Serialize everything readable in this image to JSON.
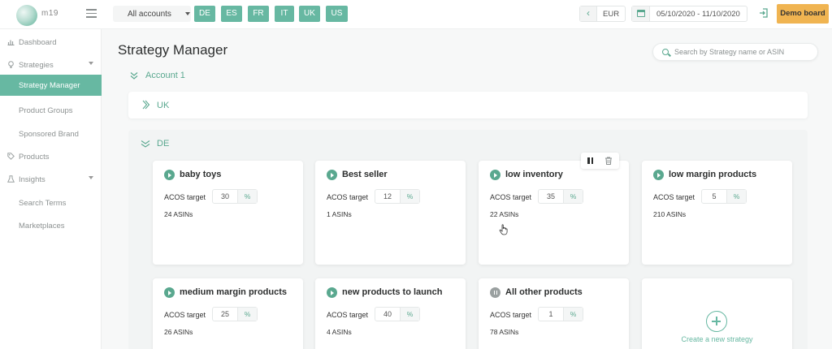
{
  "topbar": {
    "logo_text": "m19",
    "account_select": "All accounts",
    "marketplaces": [
      "DE",
      "ES",
      "FR",
      "IT",
      "UK",
      "US"
    ],
    "currency": "EUR",
    "date_range": "05/10/2020 - 11/10/2020",
    "demo_label": "Demo board"
  },
  "sidebar": {
    "items": [
      {
        "label": "Dashboard",
        "icon": "chart-icon"
      },
      {
        "label": "Strategies",
        "icon": "bulb-icon"
      },
      {
        "label": "Strategy Manager"
      },
      {
        "label": "Product Groups"
      },
      {
        "label": "Sponsored Brand"
      },
      {
        "label": "Products",
        "icon": "tag-icon"
      },
      {
        "label": "Insights",
        "icon": "flask-icon"
      },
      {
        "label": "Search Terms"
      },
      {
        "label": "Marketplaces"
      }
    ]
  },
  "main": {
    "title": "Strategy Manager",
    "search_placeholder": "Search by Strategy name or ASIN",
    "account_label": "Account 1",
    "uk_label": "UK",
    "de_label": "DE",
    "acos_label": "ACOS target",
    "pct": "%",
    "new_strategy_label": "Create a new strategy",
    "strategies": [
      {
        "name": "baby toys",
        "acos": "30",
        "asins": "24 ASINs",
        "status": "active"
      },
      {
        "name": "Best seller",
        "acos": "12",
        "asins": "1 ASINs",
        "status": "active"
      },
      {
        "name": "low inventory",
        "acos": "35",
        "asins": "22 ASINs",
        "status": "active"
      },
      {
        "name": "low margin products",
        "acos": "5",
        "asins": "210 ASINs",
        "status": "active"
      },
      {
        "name": "medium margin products",
        "acos": "25",
        "asins": "26 ASINs",
        "status": "active"
      },
      {
        "name": "new products to launch",
        "acos": "40",
        "asins": "4 ASINs",
        "status": "active"
      },
      {
        "name": "All other products",
        "acos": "1",
        "asins": "78 ASINs",
        "status": "paused"
      }
    ]
  },
  "colors": {
    "accent": "#67b8a2",
    "accent_dark": "#5aa88f",
    "demo": "#f0b451"
  }
}
